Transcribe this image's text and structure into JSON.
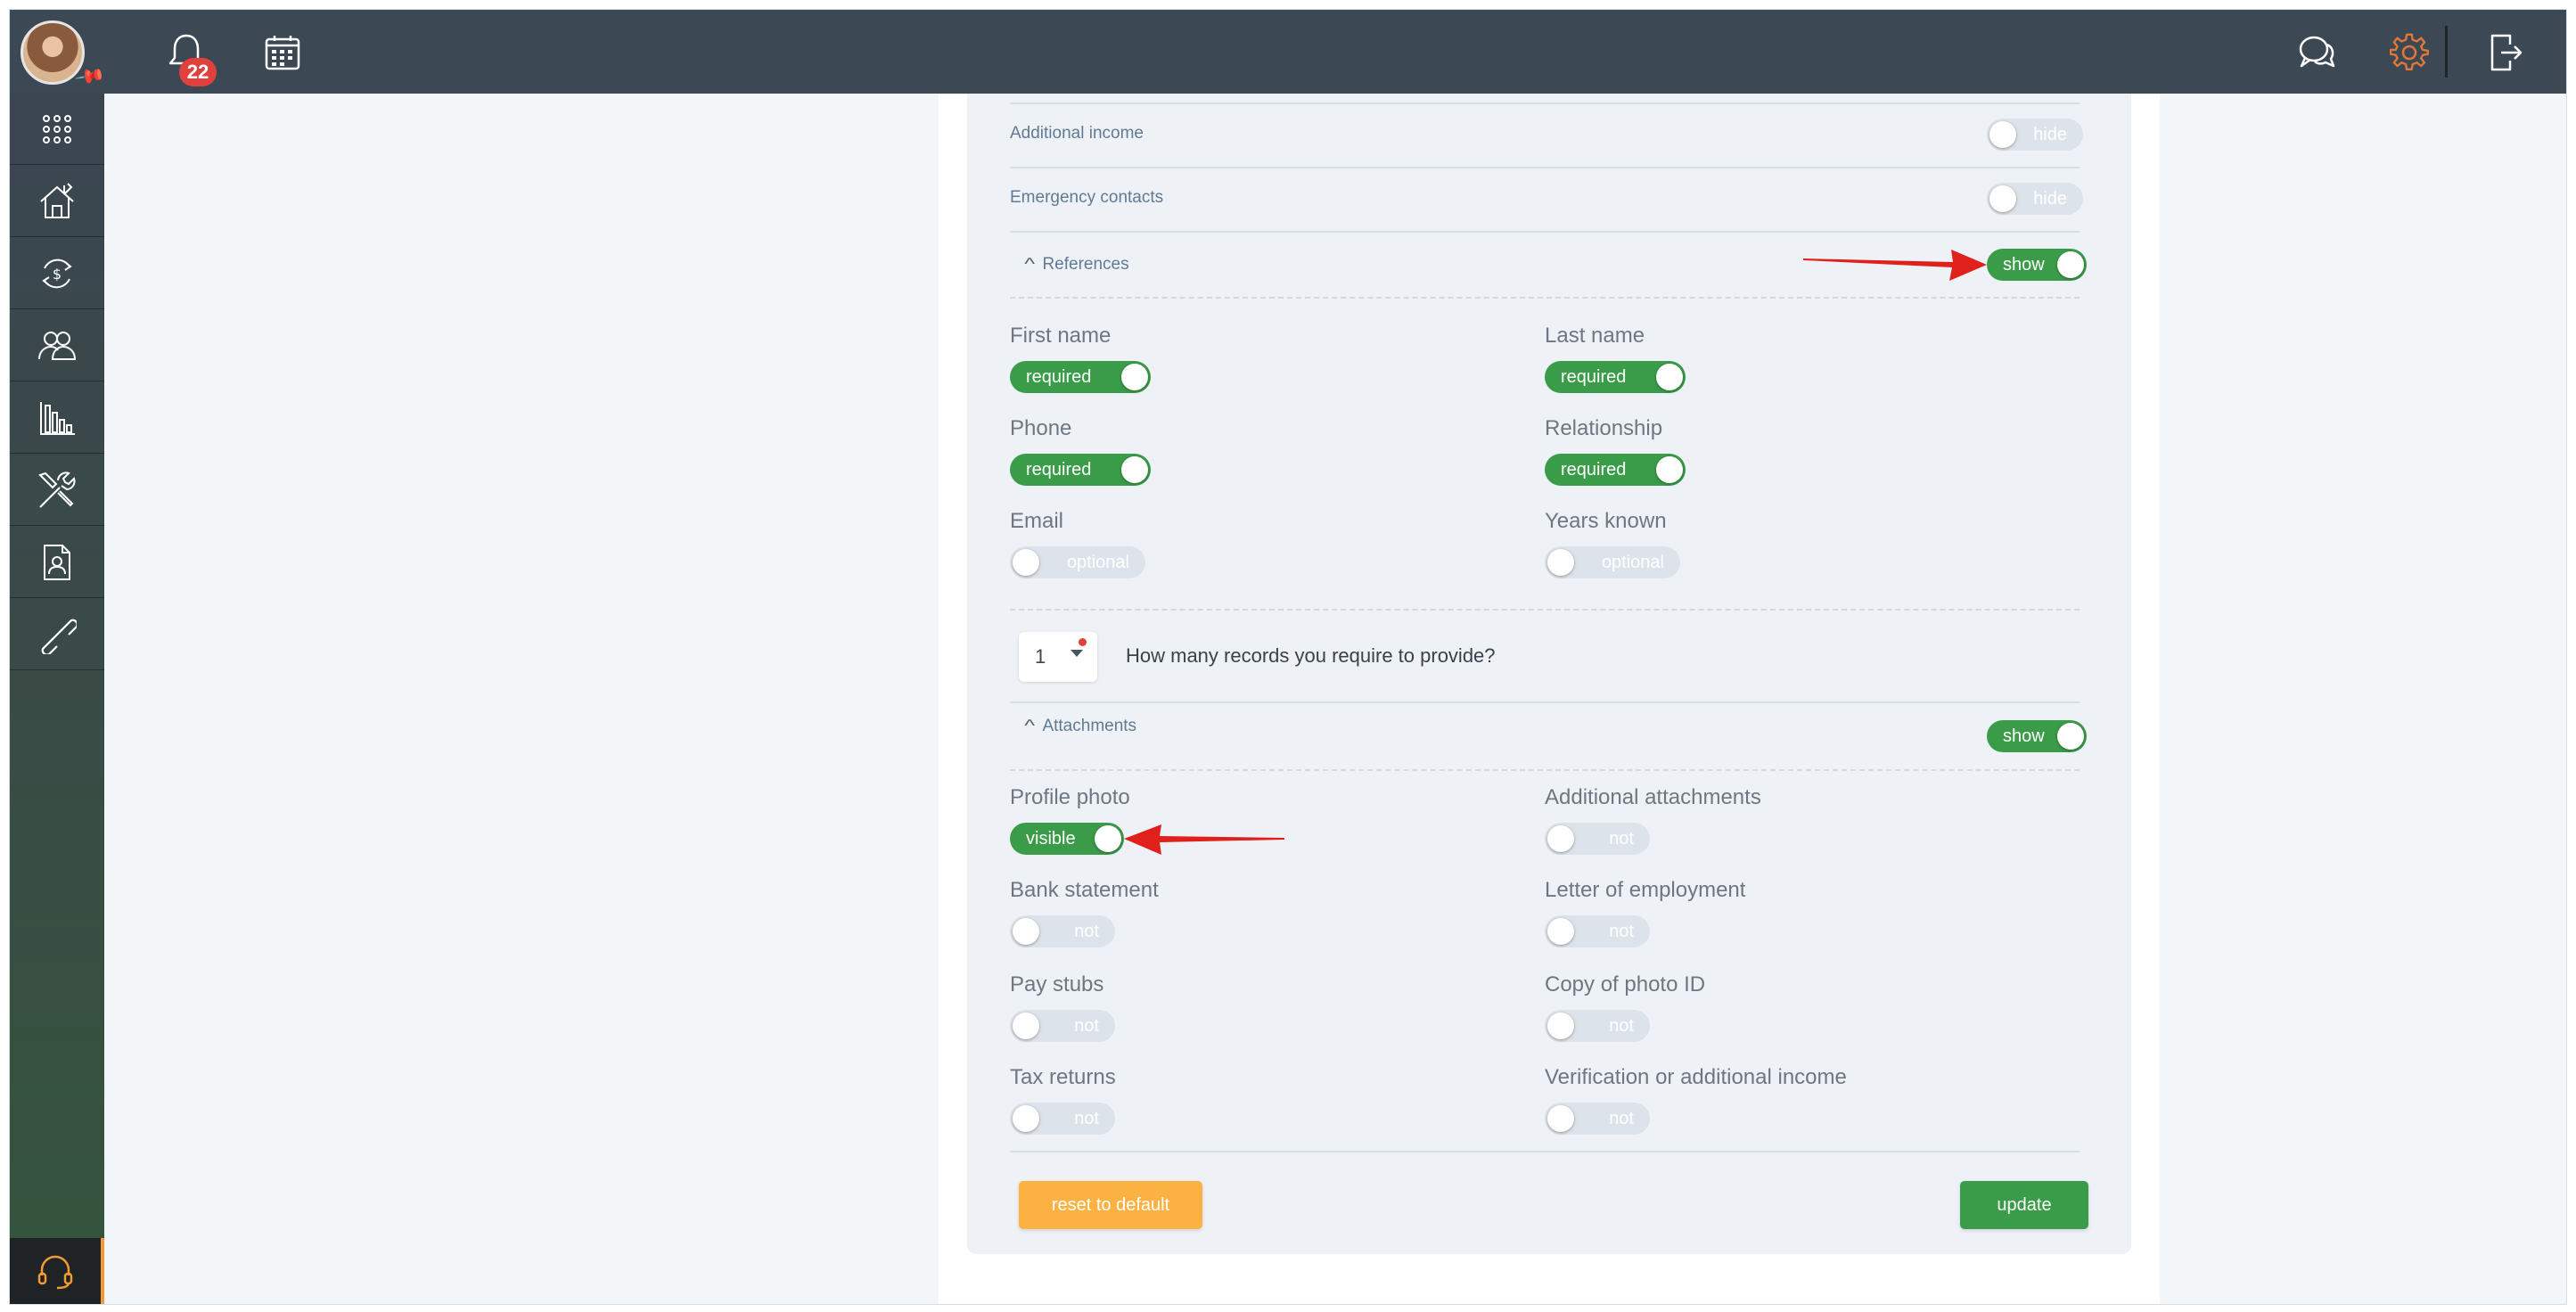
{
  "topbar": {
    "notification_count": "22",
    "icons": [
      "bell-icon",
      "calendar-icon",
      "chat-icon",
      "gear-icon",
      "logout-icon"
    ],
    "settings_accent": "#e2773a"
  },
  "sidebar": {
    "items": [
      "apps-grid-icon",
      "properties-icon",
      "finance-icon",
      "people-icon",
      "reports-icon",
      "tools-icon",
      "documents-icon",
      "links-icon"
    ],
    "support_icon": "headset-icon"
  },
  "sections": {
    "additional_income": {
      "label": "Additional income",
      "toggle": "hide"
    },
    "emergency_contacts": {
      "label": "Emergency contacts",
      "toggle": "hide"
    },
    "references": {
      "label": "References",
      "toggle": "show",
      "fields": {
        "first_name": {
          "label": "First name",
          "state": "required"
        },
        "last_name": {
          "label": "Last name",
          "state": "required"
        },
        "phone": {
          "label": "Phone",
          "state": "required"
        },
        "relationship": {
          "label": "Relationship",
          "state": "required"
        },
        "email": {
          "label": "Email",
          "state": "optional"
        },
        "years_known": {
          "label": "Years known",
          "state": "optional"
        }
      },
      "records_count": "1",
      "records_question": "How many records you require to provide?"
    },
    "attachments": {
      "label": "Attachments",
      "toggle": "show",
      "fields": {
        "profile_photo": {
          "label": "Profile photo",
          "state": "visible"
        },
        "additional_attachments": {
          "label": "Additional attachments",
          "state": "not"
        },
        "bank_statement": {
          "label": "Bank statement",
          "state": "not"
        },
        "letter_of_employment": {
          "label": "Letter of employment",
          "state": "not"
        },
        "pay_stubs": {
          "label": "Pay stubs",
          "state": "not"
        },
        "copy_of_photo_id": {
          "label": "Copy of photo ID",
          "state": "not"
        },
        "tax_returns": {
          "label": "Tax returns",
          "state": "not"
        },
        "verification_income": {
          "label": "Verification or additional income",
          "state": "not"
        }
      }
    }
  },
  "buttons": {
    "reset": "reset to default",
    "update": "update"
  },
  "colors": {
    "topbar": "#3c4853",
    "toggle_on": "#3a9c48",
    "toggle_off": "#dde3ea",
    "reset_button": "#fcb143",
    "update_button": "#3a9c48",
    "annotation_arrow": "#e0201b"
  }
}
